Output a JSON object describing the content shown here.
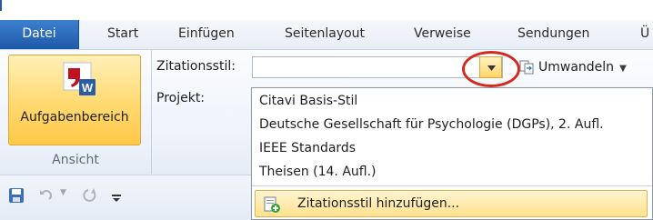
{
  "tabs": [
    {
      "label": "Datei",
      "active": true
    },
    {
      "label": "Start"
    },
    {
      "label": "Einfügen"
    },
    {
      "label": "Seitenlayout"
    },
    {
      "label": "Verweise"
    },
    {
      "label": "Sendungen"
    },
    {
      "label": "Ü"
    }
  ],
  "ribbon": {
    "big_button_label": "Aufgabenbereich",
    "group_label": "Ansicht",
    "citation_style_label": "Zitationsstil:",
    "citation_style_value": "",
    "project_label": "Projekt:",
    "convert_label": "Umwandeln"
  },
  "dropdown": {
    "items": [
      "Citavi Basis-Stil",
      "Deutsche Gesellschaft für Psychologie (DGPs), 2. Aufl.",
      "IEEE Standards",
      "Theisen (14. Aufl.)"
    ],
    "add_style_label": "Zitationsstil hinzufügen..."
  },
  "qat": {
    "items": [
      "save-icon",
      "undo-icon",
      "redo-icon",
      "customize-icon"
    ]
  },
  "colors": {
    "file_tab": "#2a67b8",
    "highlight": "#ffd56a",
    "annotation_circle": "#d42a1e"
  }
}
